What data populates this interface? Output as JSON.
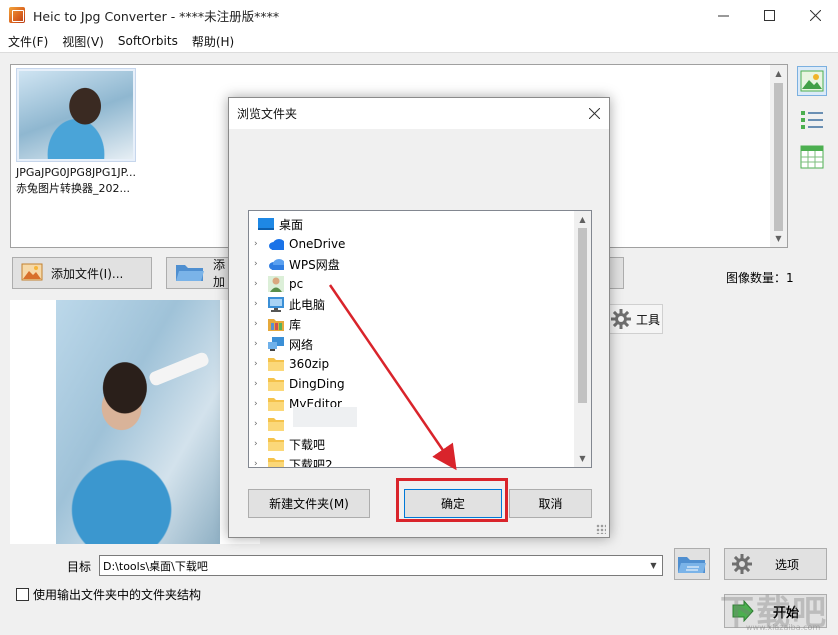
{
  "window": {
    "title": "Heic to Jpg Converter - ****未注册版****",
    "minimize": "—",
    "maximize": "☐",
    "close": "✕"
  },
  "menu": [
    "文件(F)",
    "视图(V)",
    "SoftOrbits",
    "帮助(H)"
  ],
  "file_list": {
    "items": [
      {
        "name_line1": "JPGaJPG0JPG8JPG1JP...",
        "name_line2": "赤兔图片转换器_202..."
      }
    ]
  },
  "buttons": {
    "add_file": "添加文件(I)...",
    "add_folder": "添加",
    "tools_tab": "工具",
    "options": "选项",
    "start": "开始"
  },
  "image_count": "图像数量：1",
  "output": {
    "target_label": "目标",
    "target_path": "D:\\tools\\桌面\\下载吧",
    "use_structure": "使用输出文件夹中的文件夹结构"
  },
  "dialog": {
    "title": "浏览文件夹",
    "close": "✕",
    "tree": [
      {
        "label": "桌面",
        "icon": "desktop-folder-icon",
        "expandable": false,
        "color": "#1e88e5"
      },
      {
        "label": "OneDrive",
        "icon": "cloud-icon",
        "expandable": true,
        "color": "#1a73e8"
      },
      {
        "label": "WPS网盘",
        "icon": "wps-cloud-icon",
        "expandable": true,
        "color": "#2f7de1"
      },
      {
        "label": "pc",
        "icon": "user-icon",
        "expandable": true,
        "color": "#5a8f4a"
      },
      {
        "label": "此电脑",
        "icon": "computer-icon",
        "expandable": true,
        "color": "#3b8fd6"
      },
      {
        "label": "库",
        "icon": "library-icon",
        "expandable": true,
        "color": "#e6a93b"
      },
      {
        "label": "网络",
        "icon": "network-icon",
        "expandable": true,
        "color": "#3b8fd6"
      },
      {
        "label": "360zip",
        "icon": "folder-icon",
        "expandable": true,
        "color": "#f4c24b"
      },
      {
        "label": "DingDing",
        "icon": "folder-icon",
        "expandable": true,
        "color": "#f4c24b"
      },
      {
        "label": "MyEditor",
        "icon": "folder-icon",
        "expandable": true,
        "color": "#f4c24b"
      },
      {
        "label": "",
        "icon": "folder-icon",
        "expandable": true,
        "color": "#f4c24b"
      },
      {
        "label": "下载吧",
        "icon": "folder-icon",
        "expandable": true,
        "color": "#f4c24b"
      },
      {
        "label": "下载吧2",
        "icon": "folder-icon",
        "expandable": true,
        "color": "#f4c24b"
      }
    ],
    "new_folder": "新建文件夹(M)",
    "ok": "确定",
    "cancel": "取消"
  },
  "watermark": {
    "text": "下载吧",
    "url": "www.xiazaiba.com"
  },
  "colors": {
    "highlight_red": "#d9242b",
    "accent_green": "#4caf50"
  }
}
